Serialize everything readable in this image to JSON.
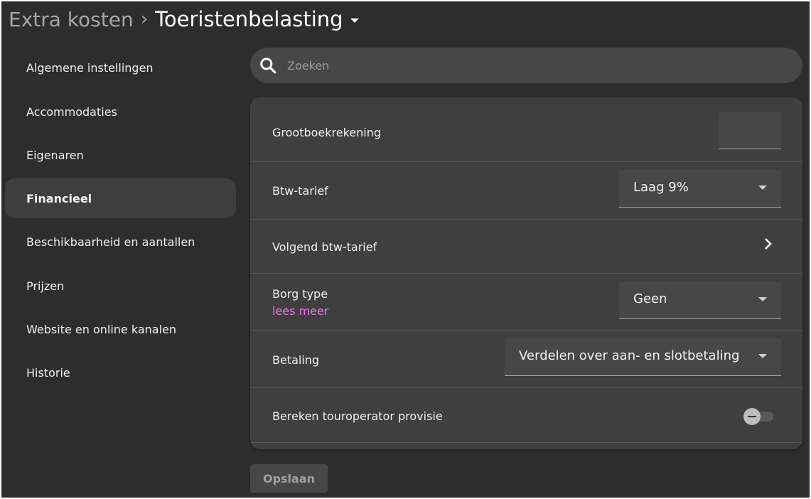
{
  "header": {
    "parent": "Extra kosten",
    "separator": "›",
    "current": "Toeristenbelasting"
  },
  "sidebar": {
    "items": [
      {
        "label": "Algemene instellingen",
        "active": false
      },
      {
        "label": "Accommodaties",
        "active": false
      },
      {
        "label": "Eigenaren",
        "active": false
      },
      {
        "label": "Financieel",
        "active": true
      },
      {
        "label": "Beschikbaarheid en aantallen",
        "active": false
      },
      {
        "label": "Prijzen",
        "active": false
      },
      {
        "label": "Website en online kanalen",
        "active": false
      },
      {
        "label": "Historie",
        "active": false
      }
    ]
  },
  "search": {
    "placeholder": "Zoeken"
  },
  "form": {
    "ledger": {
      "label": "Grootboekrekening",
      "value": ""
    },
    "vat": {
      "label": "Btw-tarief",
      "value": "Laag 9%"
    },
    "next_vat": {
      "label": "Volgend btw-tarief"
    },
    "deposit": {
      "label": "Borg type",
      "link": "lees meer",
      "value": "Geen"
    },
    "payment": {
      "label": "Betaling",
      "value": "Verdelen over aan- en slotbetaling"
    },
    "commission": {
      "label": "Bereken touroperator provisie",
      "enabled": false
    }
  },
  "actions": {
    "save_label": "Opslaan"
  },
  "colors": {
    "background": "#2d2d2d",
    "card": "#3f3f3f",
    "accent_link": "#e879e2"
  }
}
